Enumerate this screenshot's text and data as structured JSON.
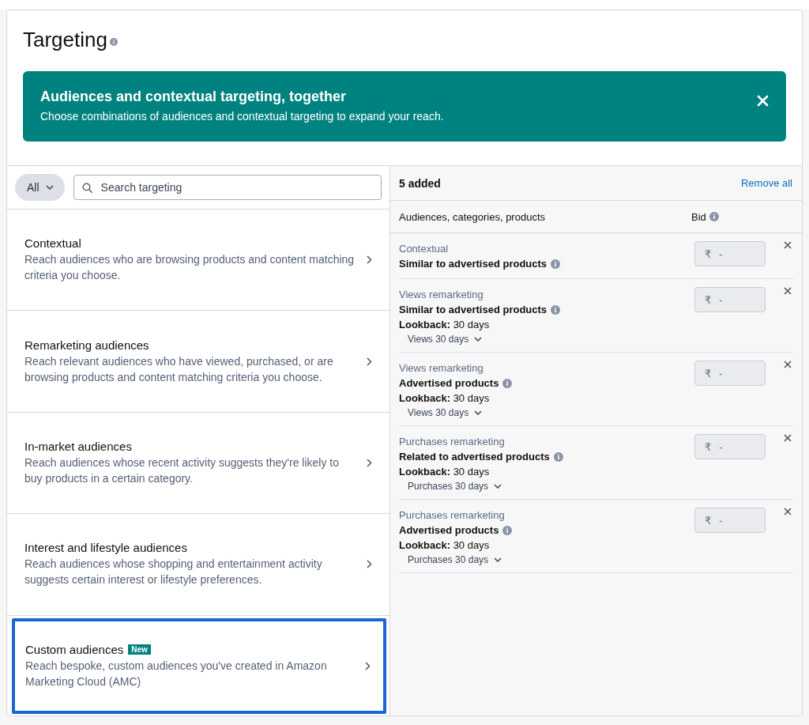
{
  "title": "Targeting",
  "banner": {
    "title": "Audiences and contextual targeting, together",
    "text": "Choose combinations of audiences and contextual targeting to expand your reach."
  },
  "filter": {
    "label": "All"
  },
  "search": {
    "placeholder": "Search targeting"
  },
  "categories": [
    {
      "title": "Contextual",
      "description": "Reach audiences who are browsing products and content matching criteria you choose.",
      "highlighted": false
    },
    {
      "title": "Remarketing audiences",
      "description": "Reach relevant audiences who have viewed, purchased, or are browsing products and content matching criteria you choose.",
      "highlighted": false
    },
    {
      "title": "In-market audiences",
      "description": "Reach audiences whose recent activity suggests they're likely to buy products in a certain category.",
      "highlighted": false
    },
    {
      "title": "Interest and lifestyle audiences",
      "description": "Reach audiences whose shopping and entertainment activity suggests certain interest or lifestyle preferences.",
      "highlighted": false
    },
    {
      "title": "Custom audiences",
      "badge": "New",
      "description": "Reach bespoke, custom audiences you've created in Amazon Marketing Cloud (AMC)",
      "highlighted": true
    }
  ],
  "added": {
    "count": "5 added",
    "remove_all": "Remove all",
    "columns": [
      "Audiences, categories, products",
      "Bid"
    ],
    "items": [
      {
        "type": "Contextual",
        "name": "Similar to advertised products",
        "currency": "₹",
        "bid": "-"
      },
      {
        "type": "Views remarketing",
        "name": "Similar to advertised products",
        "lookback": "**Lookback:** 30 days",
        "selector": "Views 30 days",
        "currency": "₹",
        "bid": "-"
      },
      {
        "type": "Views remarketing",
        "name": "Advertised products",
        "lookback": "**Lookback:** 30 days",
        "selector": "Views 30 days",
        "currency": "₹",
        "bid": "-"
      },
      {
        "type": "Purchases remarketing",
        "name": "Related to advertised products",
        "lookback": "**Lookback:** 30 days",
        "selector": "Purchases 30 days",
        "currency": "₹",
        "bid": "-"
      },
      {
        "type": "Purchases remarketing",
        "name": "Advertised products",
        "lookback": "**Lookback:** 30 days",
        "selector": "Purchases 30 days",
        "currency": "₹",
        "bid": "-"
      }
    ]
  }
}
